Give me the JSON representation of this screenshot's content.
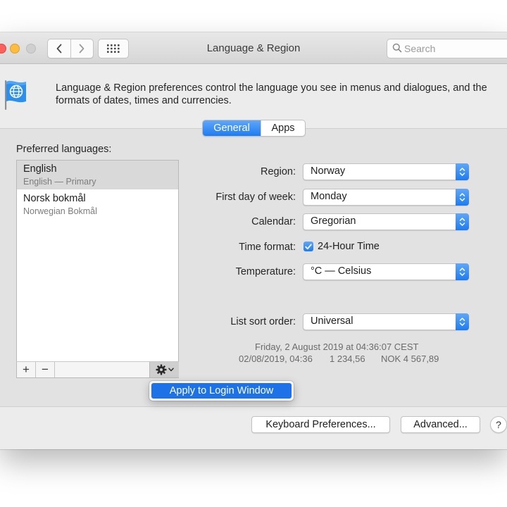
{
  "window": {
    "title": "Language & Region",
    "description": "Language & Region preferences control the language you see in menus and dialogues, and the formats of dates, times and currencies."
  },
  "search": {
    "placeholder": "Search"
  },
  "tabs": [
    {
      "label": "General",
      "selected": true
    },
    {
      "label": "Apps",
      "selected": false
    }
  ],
  "languages": {
    "heading": "Preferred languages:",
    "items": [
      {
        "name": "English",
        "subtitle": "English — Primary",
        "selected": true
      },
      {
        "name": "Norsk bokmål",
        "subtitle": "Norwegian Bokmål",
        "selected": false
      }
    ],
    "add_label": "+",
    "remove_label": "−"
  },
  "gear_menu": {
    "item": "Apply to Login Window"
  },
  "settings": {
    "region": {
      "label": "Region:",
      "value": "Norway"
    },
    "first_day": {
      "label": "First day of week:",
      "value": "Monday"
    },
    "calendar": {
      "label": "Calendar:",
      "value": "Gregorian"
    },
    "time_format": {
      "label": "Time format:",
      "checkbox_label": "24-Hour Time",
      "checked": true
    },
    "temperature": {
      "label": "Temperature:",
      "value": "°C — Celsius"
    },
    "sort_order": {
      "label": "List sort order:",
      "value": "Universal"
    }
  },
  "sample": {
    "long_date": "Friday, 2 August 2019 at 04:36:07 CEST",
    "short_date": "02/08/2019, 04:36",
    "number": "1 234,56",
    "currency": "NOK 4 567,89"
  },
  "buttons": {
    "keyboard": "Keyboard Preferences...",
    "advanced": "Advanced...",
    "help": "?"
  },
  "colors": {
    "accent": "#1d7cf2",
    "close": "#fc605c",
    "minimize": "#fdbc40"
  }
}
